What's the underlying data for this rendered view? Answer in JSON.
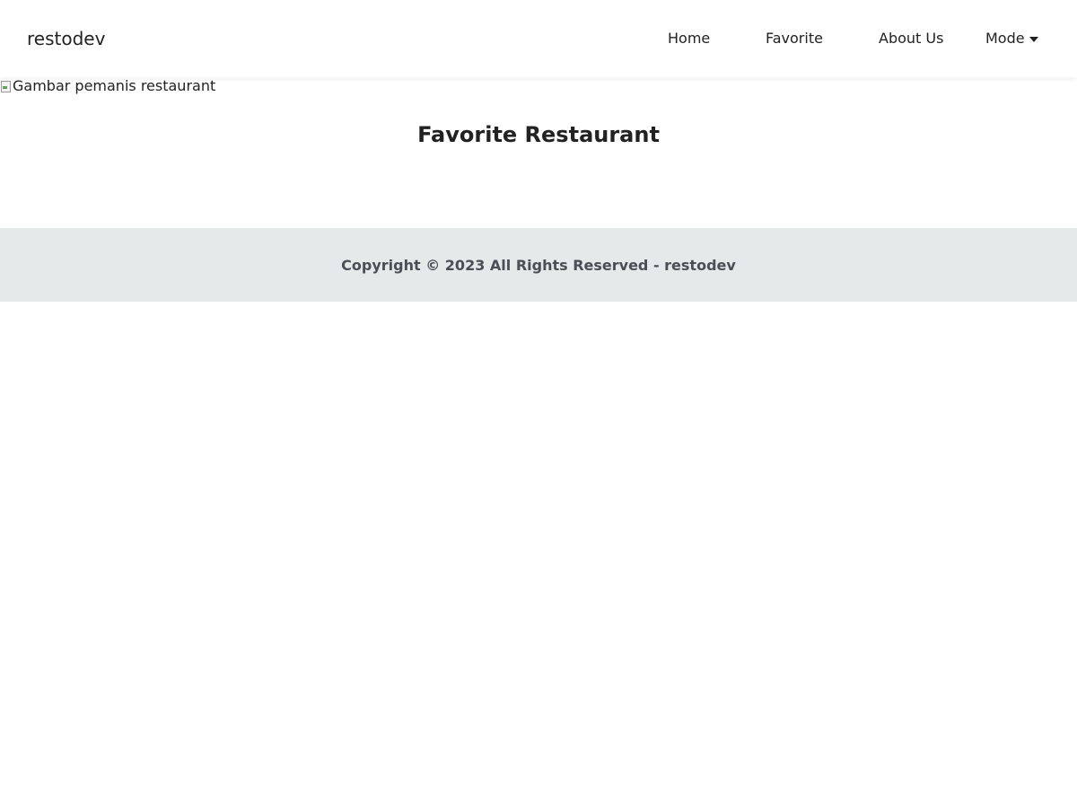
{
  "header": {
    "brand": "restodev",
    "nav": {
      "home": "Home",
      "favorite": "Favorite",
      "about": "About Us",
      "mode": "Mode"
    }
  },
  "hero": {
    "alt_text": "Gambar pemanis restaurant"
  },
  "main": {
    "title": "Favorite Restaurant"
  },
  "footer": {
    "text": "Copyright © 2023 All Rights Reserved - restodev"
  },
  "icons": {
    "mode_caret": "caret-down-icon",
    "hero_image": "broken-image-icon"
  },
  "colors": {
    "footer_bg": "#e5e9ea",
    "footer_text": "#4a4f55",
    "text": "#222222"
  }
}
